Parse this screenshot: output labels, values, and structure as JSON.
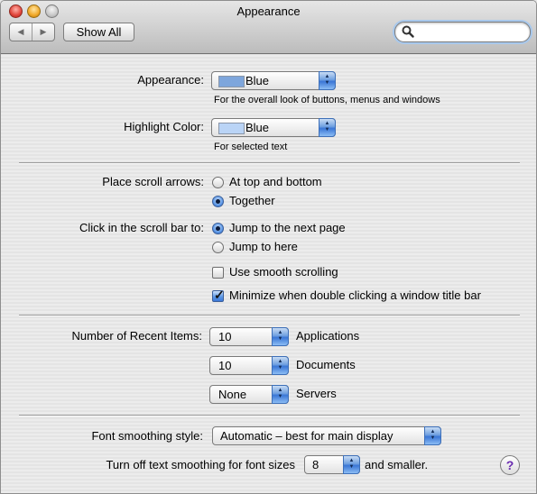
{
  "window": {
    "title": "Appearance"
  },
  "toolbar": {
    "back": "◀",
    "forward": "▶",
    "show_all": "Show All",
    "search_value": ""
  },
  "appearance": {
    "label": "Appearance:",
    "value": "Blue",
    "note": "For the overall look of buttons, menus and windows",
    "swatch_color": "#7ea6dc"
  },
  "highlight": {
    "label": "Highlight Color:",
    "value": "Blue",
    "note": "For selected text",
    "swatch_color": "#bad4f6"
  },
  "scroll_arrows": {
    "label": "Place scroll arrows:",
    "options": [
      {
        "label": "At top and bottom",
        "selected": false
      },
      {
        "label": "Together",
        "selected": true
      }
    ]
  },
  "scroll_bar_click": {
    "label": "Click in the scroll bar to:",
    "options": [
      {
        "label": "Jump to the next page",
        "selected": true
      },
      {
        "label": "Jump to here",
        "selected": false
      }
    ]
  },
  "checkboxes": [
    {
      "label": "Use smooth scrolling",
      "checked": false
    },
    {
      "label": "Minimize when double clicking a window title bar",
      "checked": true
    }
  ],
  "recent_items": {
    "label": "Number of Recent Items:",
    "rows": [
      {
        "value": "10",
        "label": "Applications"
      },
      {
        "value": "10",
        "label": "Documents"
      },
      {
        "value": "None",
        "label": "Servers"
      }
    ]
  },
  "font_smoothing": {
    "label": "Font smoothing style:",
    "value": "Automatic – best for main display"
  },
  "text_smoothing": {
    "label": "Turn off text smoothing for font sizes",
    "value": "8",
    "suffix": "and smaller."
  },
  "help": {
    "symbol": "?"
  },
  "colors": {
    "accent": "#3a76d6",
    "help": "#6a2bb0"
  }
}
